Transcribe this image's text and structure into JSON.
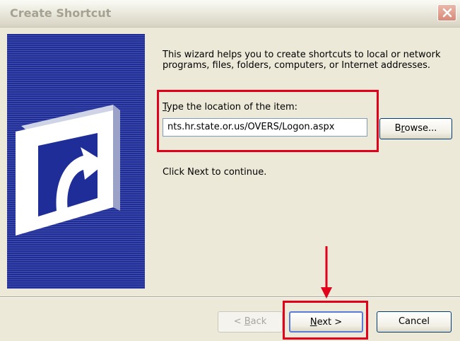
{
  "window": {
    "title": "Create Shortcut"
  },
  "wizard": {
    "intro_text": "This wizard helps you to create shortcuts to local or network programs, files, folders, computers, or Internet addresses.",
    "location_label_accel": "T",
    "location_label_rest": "ype the location of the item:",
    "location_value": "nts.hr.state.or.us/OVERS/Logon.aspx",
    "browse_accel": "r",
    "browse_pre": "B",
    "browse_post": "owse...",
    "continue_text": "Click Next to continue."
  },
  "footer": {
    "back_pre": "< ",
    "back_accel": "B",
    "back_post": "ack",
    "next_accel": "N",
    "next_post": "ext >",
    "cancel_label": "Cancel"
  },
  "icons": {
    "close": "close-icon",
    "shortcut": "shortcut-arrow-icon",
    "annotation_arrow": "red-down-arrow-icon"
  },
  "colors": {
    "banner": "#1f2d98",
    "highlight": "#e3001b",
    "dialog_bg": "#ece9d8"
  }
}
